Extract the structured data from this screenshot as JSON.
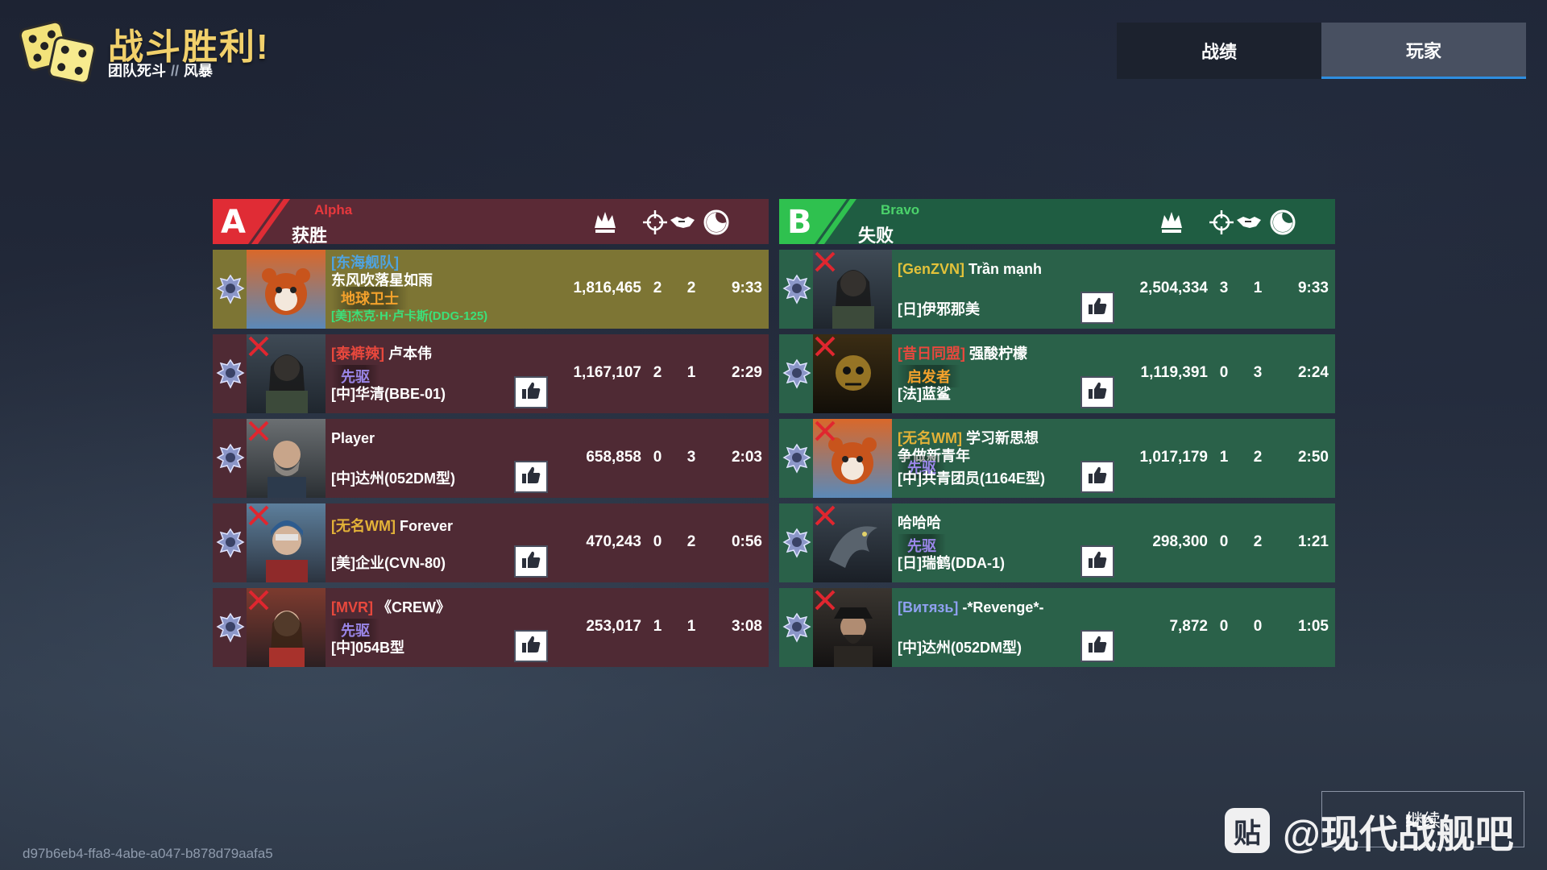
{
  "header": {
    "title": "战斗胜利!",
    "mode": "团队死斗",
    "mode_separator": "//",
    "map": "风暴"
  },
  "tabs": [
    {
      "label": "战绩",
      "active": false
    },
    {
      "label": "玩家",
      "active": true
    }
  ],
  "teams": {
    "alpha": {
      "letter": "A",
      "name": "Alpha",
      "result": "获胜",
      "players": [
        {
          "clan": "[东海舰队]",
          "clan_color": "#4fa3e0",
          "name": "东风吹落星如雨",
          "title": "地球卫士",
          "title_color": "#f4a22c",
          "ship": "[美]杰克·H·卢卡斯(DDG-125)",
          "ship_color": "#3ce07a",
          "score": "1,816,465",
          "kills": "2",
          "assists": "2",
          "time": "9:33",
          "dead": false,
          "is_me": true,
          "avatar": "red-panda"
        },
        {
          "clan": "[泰裤辣]",
          "clan_color": "#e8483d",
          "name": "卢本伟",
          "title": "先驱",
          "title_color": "#9a86e8",
          "ship": "[中]华清(BBE-01)",
          "ship_color": "#ffffff",
          "score": "1,167,107",
          "kills": "2",
          "assists": "1",
          "time": "2:29",
          "dead": true,
          "is_me": false,
          "avatar": "soldier-woman"
        },
        {
          "clan": "",
          "clan_color": "#ffffff",
          "name": "Player",
          "title": "",
          "title_color": "#ffffff",
          "ship": "[中]达州(052DM型)",
          "ship_color": "#ffffff",
          "score": "658,858",
          "kills": "0",
          "assists": "3",
          "time": "2:03",
          "dead": true,
          "is_me": false,
          "avatar": "bearded-captain"
        },
        {
          "clan": "[无名WM]",
          "clan_color": "#e3b238",
          "name": "Forever",
          "title": "",
          "title_color": "#ffffff",
          "ship": "[美]企业(CVN-80)",
          "ship_color": "#ffffff",
          "score": "470,243",
          "kills": "0",
          "assists": "2",
          "time": "0:56",
          "dead": true,
          "is_me": false,
          "avatar": "pilot"
        },
        {
          "clan": "[MVR]",
          "clan_color": "#e8483d",
          "name": "《CREW》",
          "title": "先驱",
          "title_color": "#9a86e8",
          "ship": "[中]054B型",
          "ship_color": "#ffffff",
          "score": "253,017",
          "kills": "1",
          "assists": "1",
          "time": "3:08",
          "dead": true,
          "is_me": false,
          "avatar": "woman"
        }
      ]
    },
    "bravo": {
      "letter": "B",
      "name": "Bravo",
      "result": "失败",
      "players": [
        {
          "clan": "[GenZVN]",
          "clan_color": "#e3c23a",
          "name": "Trần mạnh",
          "title": "",
          "title_color": "#ffffff",
          "ship": "[日]伊邪那美",
          "ship_color": "#ffffff",
          "score": "2,504,334",
          "kills": "3",
          "assists": "1",
          "time": "9:33",
          "dead": true,
          "is_me": false,
          "avatar": "soldier-woman"
        },
        {
          "clan": "[昔日同盟]",
          "clan_color": "#e8483d",
          "name": "强酸柠檬",
          "title": "启发者",
          "title_color": "#f4a22c",
          "ship": "[法]蓝鲨",
          "ship_color": "#ffffff",
          "score": "1,119,391",
          "kills": "0",
          "assists": "3",
          "time": "2:24",
          "dead": true,
          "is_me": false,
          "avatar": "golden-skull"
        },
        {
          "clan": "[无名WM]",
          "clan_color": "#e3b238",
          "name": "学习新思想",
          "name2": "争做新青年",
          "title": "先驱",
          "title_color": "#9a86e8",
          "ship": "[中]共青团员(1164E型)",
          "ship_color": "#ffffff",
          "score": "1,017,179",
          "kills": "1",
          "assists": "2",
          "time": "2:50",
          "dead": true,
          "is_me": false,
          "avatar": "red-panda"
        },
        {
          "clan": "",
          "clan_color": "#ffffff",
          "name": "哈哈哈",
          "title": "先驱",
          "title_color": "#9a86e8",
          "ship": "[日]瑞鹤(DDA-1)",
          "ship_color": "#ffffff",
          "score": "298,300",
          "kills": "0",
          "assists": "2",
          "time": "1:21",
          "dead": true,
          "is_me": false,
          "avatar": "dragon"
        },
        {
          "clan": "[Витязь]",
          "clan_color": "#8fa0f0",
          "name": "-*Revenge*-",
          "title": "",
          "title_color": "#ffffff",
          "ship": "[中]达州(052DM型)",
          "ship_color": "#ffffff",
          "score": "7,872",
          "kills": "0",
          "assists": "0",
          "time": "1:05",
          "dead": true,
          "is_me": false,
          "avatar": "pirate"
        }
      ]
    }
  },
  "stat_icons": [
    "score-icon",
    "kills-icon",
    "assists-icon",
    "time-icon"
  ],
  "footer": {
    "game_id": "d97b6eb4-ffa8-4abe-a047-b878d79aafa5",
    "continue_label": "继续",
    "watermark": "@现代战舰吧",
    "watermark_icon": "贴"
  },
  "colors": {
    "alpha_accent": "#e02c35",
    "bravo_accent": "#2fc14f",
    "title_gold": "#f1d06b",
    "tab_underline": "#2e8ee0"
  }
}
